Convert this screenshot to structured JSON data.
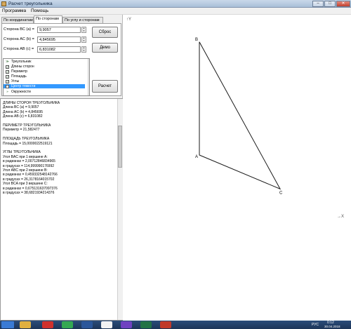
{
  "window": {
    "title": "Расчет треугольника",
    "min": "–",
    "max": "□",
    "close": "✕"
  },
  "menu": [
    "Программа",
    "Помощь"
  ],
  "tabs": [
    "По координатам",
    "По сторонам",
    "По углу и сторонам"
  ],
  "fields": [
    {
      "label": "Сторона BC (a) =",
      "value": "9,9057"
    },
    {
      "label": "Сторона AC (b) =",
      "value": "4,845695"
    },
    {
      "label": "Сторона AB (c) =",
      "value": "6,831082"
    }
  ],
  "buttons": {
    "reset": "Сброс",
    "demo": "Демо",
    "calc": "Расчет"
  },
  "options": [
    {
      "label": "Треугольник",
      "kind": "group",
      "checked": null
    },
    {
      "label": "Длины сторон",
      "kind": "item",
      "checked": true
    },
    {
      "label": "Периметр",
      "kind": "item",
      "checked": true
    },
    {
      "label": "Площадь",
      "kind": "item",
      "checked": true
    },
    {
      "label": "Углы",
      "kind": "item",
      "checked": true
    },
    {
      "label": "Центр тяжести",
      "kind": "item",
      "checked": false,
      "selected": true
    },
    {
      "label": "Окружности",
      "kind": "group",
      "checked": null
    }
  ],
  "output_lines": [
    "ДЛИНЫ СТОРОН ТРЕУГОЛЬНИКА",
    "  Длина BC (a) = 9,9057",
    "  Длина AC (b) = 4,845695",
    "  Длина AB (c) = 6,831082",
    "",
    "ПЕРИМЕТР ТРЕУГОЛЬНИКА",
    "  Периметр = 21,582477",
    "",
    "ПЛОЩАДЬ ТРЕУГОЛЬНИКА",
    "  Площадь = 15,0000022519121",
    "",
    "УГЛЫ ТРЕУГОЛЬНИКА",
    "  Угол BAC при 1 вершине A:",
    "    в радианах = 2,00712846834965",
    "    в градусах = 114,999990176992",
    "  Угол ABC при 2 вершине B:",
    "    в радианах = 0,459332548142766",
    "    в градусах = 26,3178164015702",
    "  Угол BCA при 3 вершине C:",
    "    в радианах = 0,675131637097376",
    "    в градусах = 38,6821934214376"
  ],
  "plot": {
    "y_axis_label": "↑Y",
    "x_axis_label": "→X",
    "vertices": [
      {
        "name": "B",
        "x": 0,
        "y": 6.831082
      },
      {
        "name": "A",
        "x": 0,
        "y": 0
      },
      {
        "name": "C",
        "x": 4.3915,
        "y": -2.0478
      }
    ]
  },
  "taskbar": {
    "apps": [
      "start",
      "explorer",
      "opera",
      "chrome",
      "word",
      "paint",
      "photos",
      "excel",
      "triangle-app"
    ],
    "lang": "РУС",
    "time": "0:12",
    "date": "30.04.2018"
  },
  "colors": {
    "accent": "#3a6ea8",
    "line": "#1a1a1a",
    "selection": "#3399ff",
    "taskbar": "#1d3558"
  }
}
